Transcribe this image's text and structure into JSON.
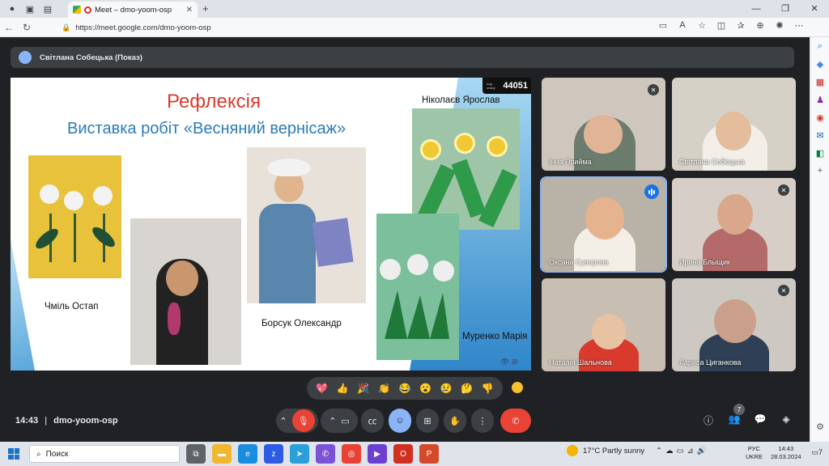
{
  "browser": {
    "tab_title": "Meet – dmo-yoom-osp",
    "tab_close": "✕",
    "new_tab": "+",
    "url": "https://meet.google.com/dmo-yoom-osp",
    "window_min": "—",
    "window_max": "❐",
    "window_close": "✕"
  },
  "meet": {
    "presenter_label": "Світлана Собецька (Показ)",
    "time": "14:43",
    "separator": "|",
    "meeting_code": "dmo-yoom-osp",
    "participants_count": "7",
    "reactions": [
      "💖",
      "👍",
      "🎉",
      "👏",
      "😂",
      "😮",
      "😢",
      "🤔",
      "👎"
    ]
  },
  "slide": {
    "title": "Рефлексія",
    "subtitle": "Виставка робіт «Весняний вернісаж»",
    "counter_prefix": "код класу",
    "counter": "44051",
    "captions": {
      "chmil": "Чміль Остап",
      "borsuk": "Борсук Олександр",
      "nikolaev": "Ніколаєв Ярослав",
      "murenko": "Муренко Марія"
    }
  },
  "participants": [
    {
      "name": "Інна Прийма",
      "state": "muted"
    },
    {
      "name": "Світлана Собецька",
      "state": "none"
    },
    {
      "name": "Оксана Суворова",
      "state": "speaking"
    },
    {
      "name": "Ирина Блыщик",
      "state": "muted"
    },
    {
      "name": "Наталія Шальнова",
      "state": "none"
    },
    {
      "name": "Лариса Циганкова",
      "state": "muted"
    }
  ],
  "taskbar": {
    "search_label": "Поиск",
    "weather": "17°C Partly sunny",
    "lang_top": "РУС",
    "lang_bottom": "UKRE",
    "time": "14:43",
    "date": "28.03.2024",
    "notifications": "7"
  }
}
